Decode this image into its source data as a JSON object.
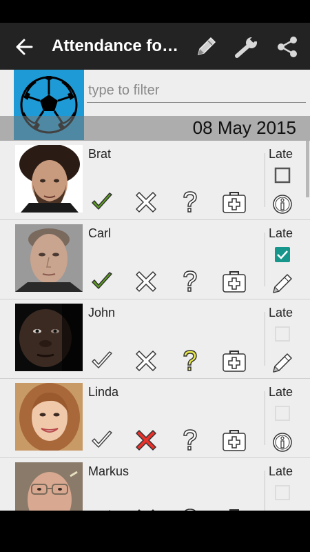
{
  "app_bar": {
    "title": "Attendance football",
    "back_icon": "arrow-back-icon",
    "actions": [
      "pencil-icon",
      "wrench-icon",
      "share-icon"
    ]
  },
  "filter": {
    "placeholder": "type to filter",
    "value": ""
  },
  "date": "08 May 2015",
  "late_label": "Late",
  "colors": {
    "accent": "#1e9bd6",
    "present": "#5ca01e",
    "absent": "#e8322c",
    "unknown": "#e8e84a",
    "checked": "#17968b"
  },
  "players": [
    {
      "name": "Brat",
      "status": "present",
      "late": "unchecked",
      "action_icon": "info-icon"
    },
    {
      "name": "Carl",
      "status": "present",
      "late": "checked",
      "action_icon": "pencil-icon"
    },
    {
      "name": "John",
      "status": "unknown",
      "late": "disabled",
      "action_icon": "pencil-icon"
    },
    {
      "name": "Linda",
      "status": "absent",
      "late": "disabled",
      "action_icon": "info-icon"
    },
    {
      "name": "Markus",
      "status": "none",
      "late": "disabled",
      "action_icon": "pencil-icon"
    }
  ]
}
